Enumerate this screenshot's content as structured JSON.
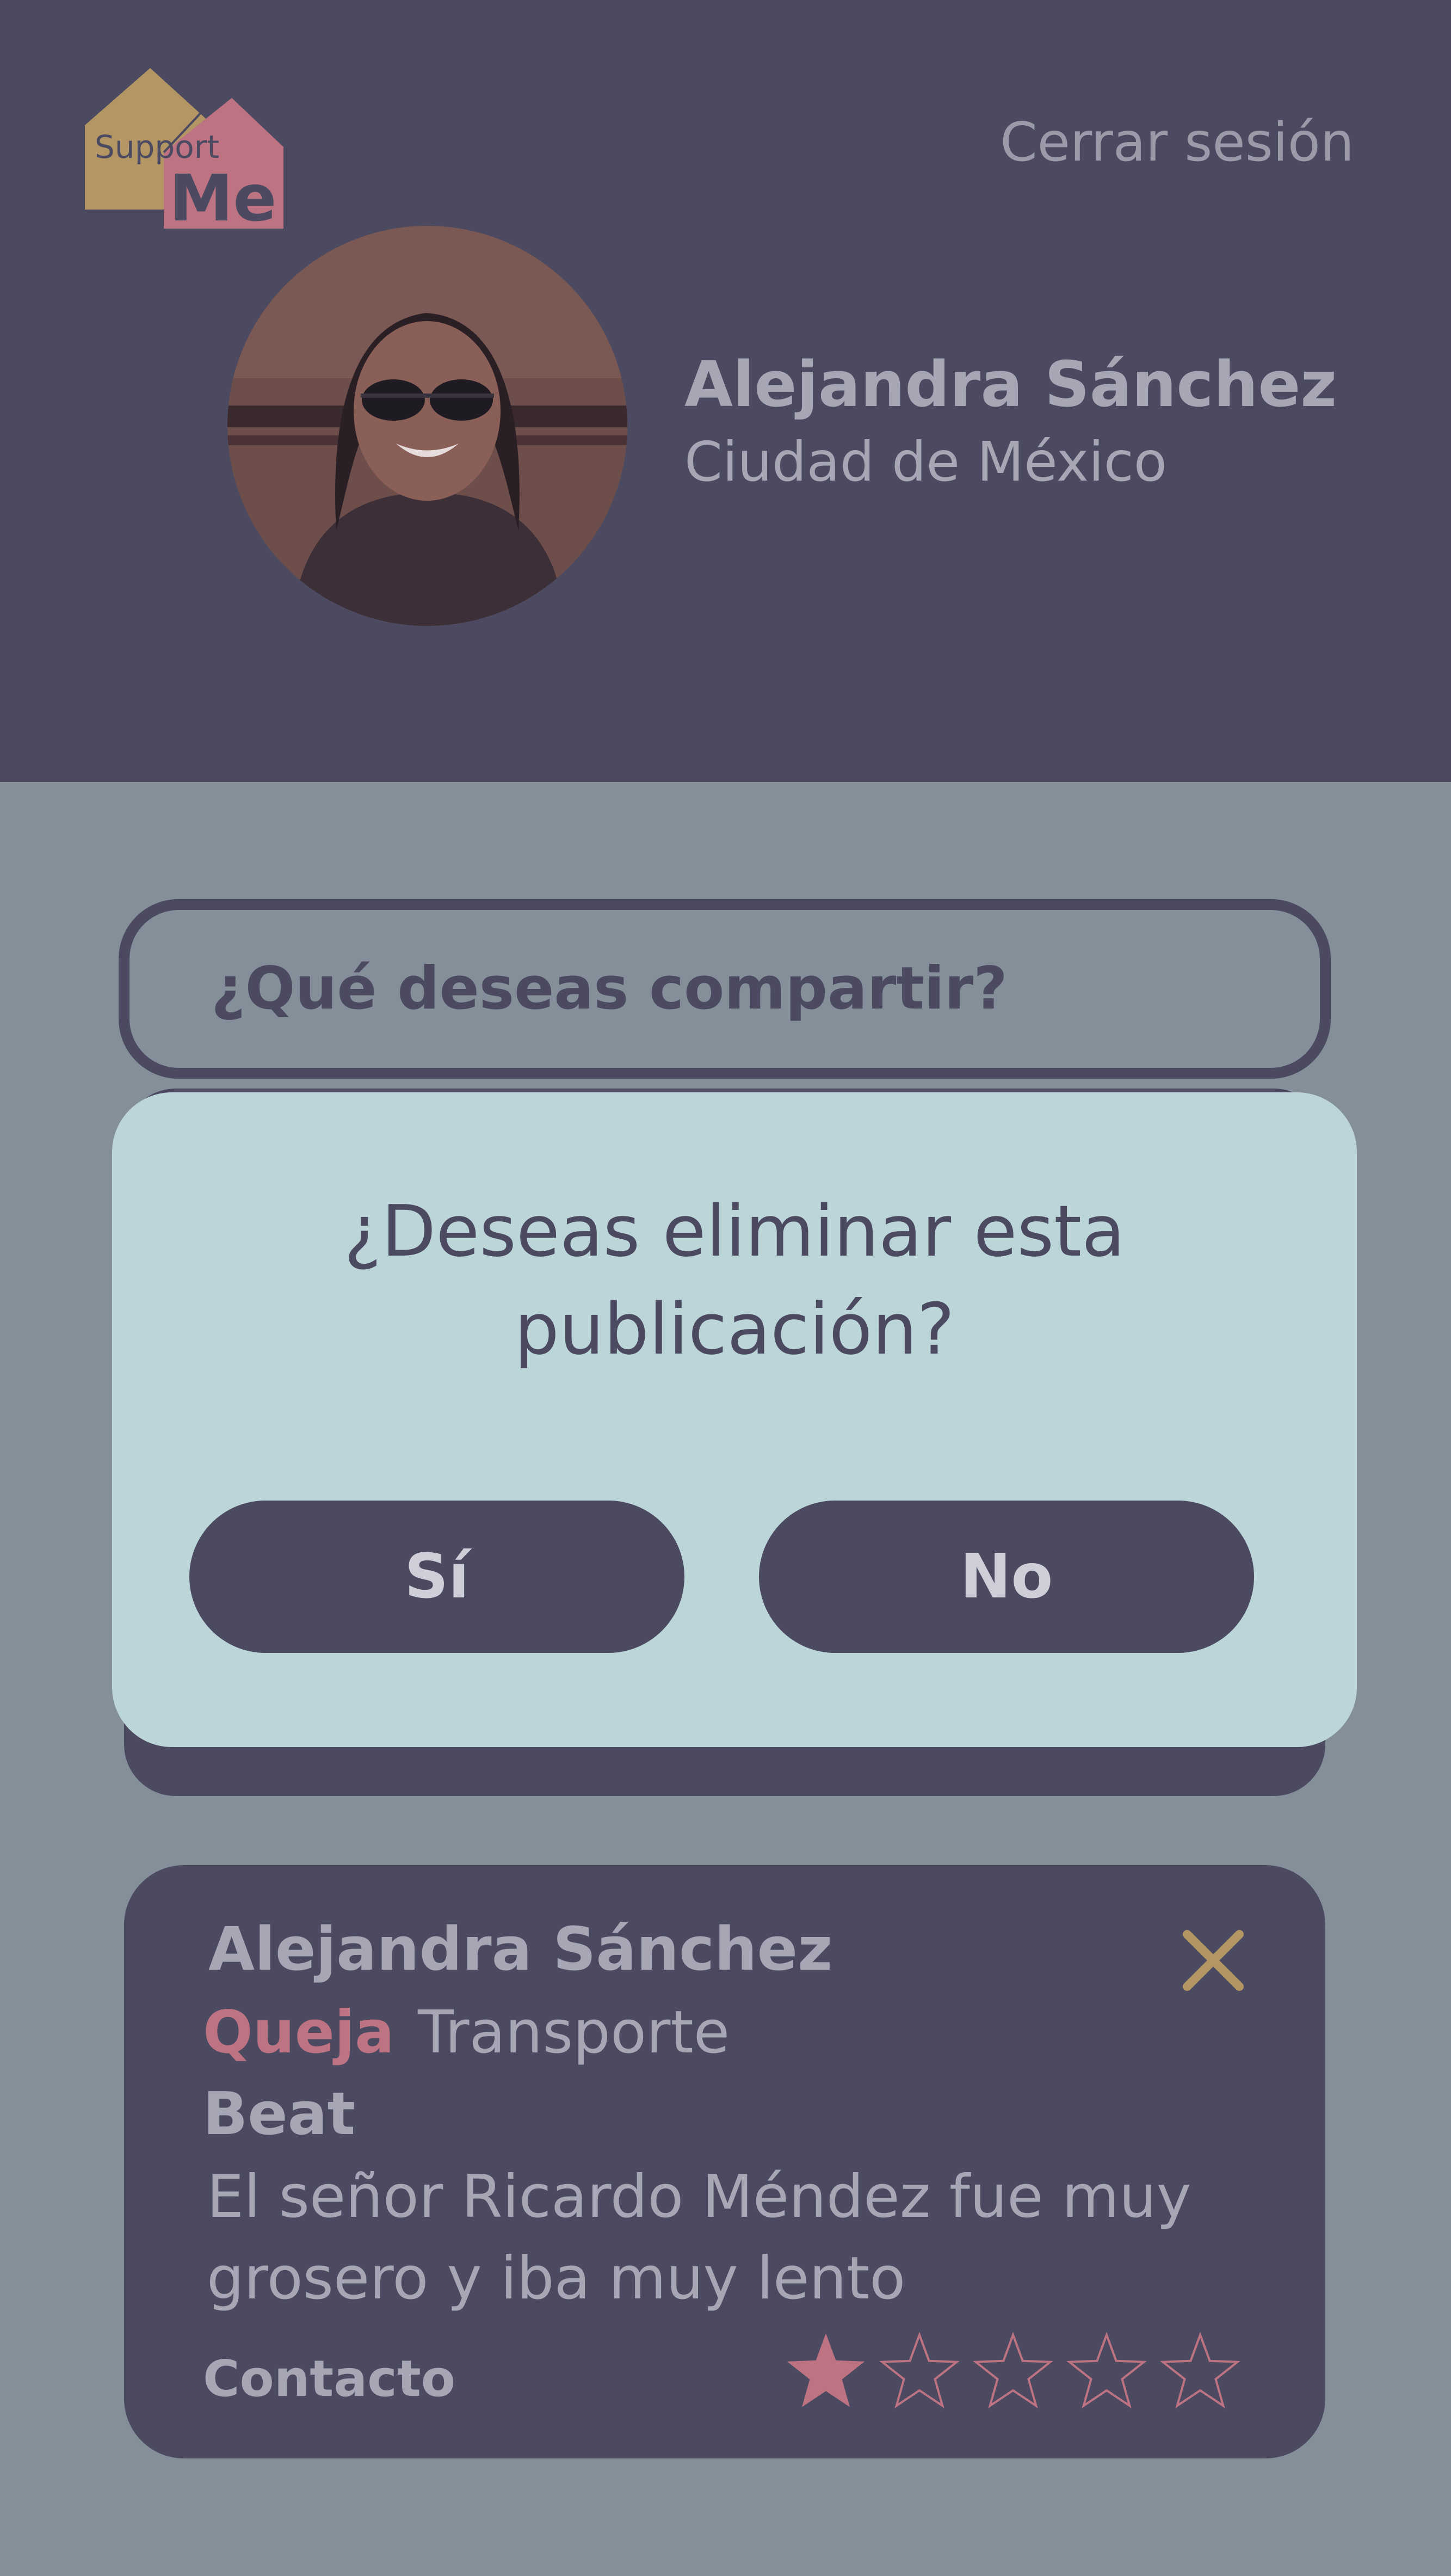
{
  "header": {
    "logo": {
      "line1": "Support",
      "line2": "Me"
    },
    "logout_label": "Cerrar sesión",
    "profile": {
      "name": "Alejandra Sánchez",
      "city": "Ciudad de México"
    }
  },
  "compose": {
    "placeholder": "¿Qué deseas compartir?"
  },
  "dialog": {
    "title_line1": "¿Deseas eliminar esta",
    "title_line2": "publicación?",
    "yes_label": "Sí",
    "no_label": "No"
  },
  "post": {
    "author": "Alejandra Sánchez",
    "type": "Queja",
    "category": "Transporte",
    "company": "Beat",
    "text": "El señor Ricardo Méndez fue muy grosero y iba muy lento",
    "contact_label": "Contacto",
    "rating": 1,
    "rating_max": 5
  },
  "colors": {
    "header_bg": "#4b4a61",
    "page_bg": "#848f9a",
    "dialog_bg": "#bcd5d8",
    "accent_pink": "#bd7382",
    "accent_gold": "#b39664",
    "muted_text": "#a6a6b5"
  }
}
